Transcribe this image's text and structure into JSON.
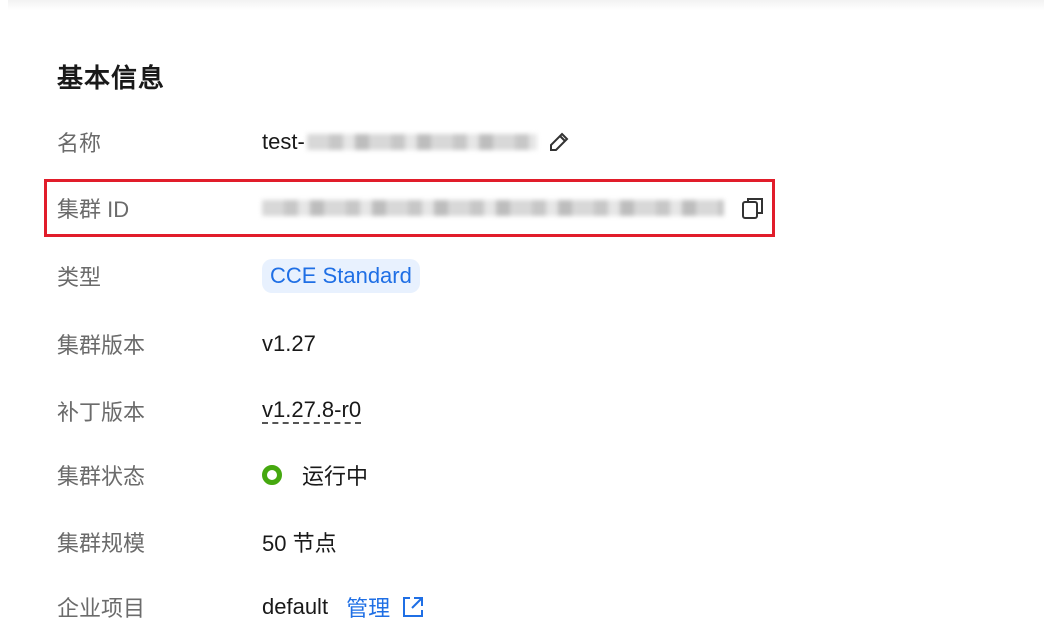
{
  "section": {
    "title": "基本信息"
  },
  "rows": {
    "name": {
      "label": "名称",
      "value_prefix": "test-",
      "icon": "edit-icon"
    },
    "cluster_id": {
      "label": "集群 ID",
      "icon": "copy-icon"
    },
    "type": {
      "label": "类型",
      "value": "CCE Standard"
    },
    "version": {
      "label": "集群版本",
      "value": "v1.27"
    },
    "patch": {
      "label": "补丁版本",
      "value": "v1.27.8-r0"
    },
    "status": {
      "label": "集群状态",
      "value": "运行中",
      "color": "#45a80f"
    },
    "scale": {
      "label": "集群规模",
      "value": "50 节点"
    },
    "project": {
      "label": "企业项目",
      "value": "default",
      "link": "管理",
      "icon": "external-link-icon"
    }
  },
  "colors": {
    "highlight": "#e11d2a",
    "accent": "#1f6fe5"
  }
}
